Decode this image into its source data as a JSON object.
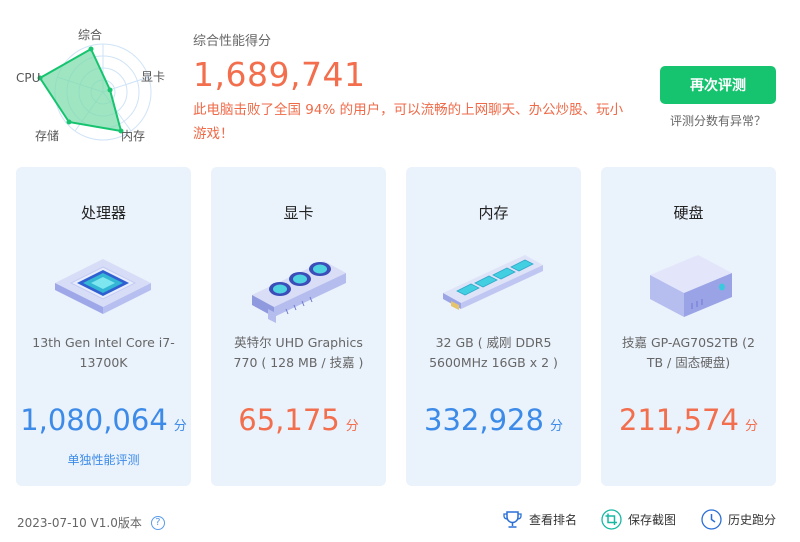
{
  "radar": {
    "labels": {
      "overall": "综合",
      "gpu": "显卡",
      "memory": "内存",
      "storage": "存储",
      "cpu": "CPU"
    }
  },
  "overall": {
    "title": "综合性能得分",
    "score": "1,689,741",
    "description": "此电脑击败了全国 94% 的用户，可以流畅的上网聊天、办公炒股、玩小游戏！"
  },
  "actions": {
    "retest_label": "再次评测",
    "anomaly_label": "评测分数有异常？"
  },
  "cards": [
    {
      "title": "处理器",
      "desc": "13th Gen Intel Core i7-13700K",
      "score": "1,080,064",
      "unit": "分",
      "link": "单独性能评测",
      "color": "#3d8be8"
    },
    {
      "title": "显卡",
      "desc": "英特尔 UHD Graphics 770 ( 128 MB / 技嘉 )",
      "score": "65,175",
      "unit": "分",
      "color": "#f26e4c"
    },
    {
      "title": "内存",
      "desc": "32 GB ( 威刚 DDR5 5600MHz 16GB x 2 )",
      "score": "332,928",
      "unit": "分",
      "color": "#3d8be8"
    },
    {
      "title": "硬盘",
      "desc": "技嘉 GP-AG70S2TB (2 TB / 固态硬盘)",
      "score": "211,574",
      "unit": "分",
      "color": "#f26e4c"
    }
  ],
  "footer": {
    "version": "2023-07-10 V1.0版本",
    "help_icon": "question-icon",
    "rank_label": "查看排名",
    "screenshot_label": "保存截图",
    "history_label": "历史跑分"
  },
  "colors": {
    "accent_green": "#16c46f",
    "score_orange": "#f26e4c",
    "score_blue": "#3d8be8",
    "card_bg": "#eaf2fc",
    "radar_fill": "#7fdcae"
  }
}
